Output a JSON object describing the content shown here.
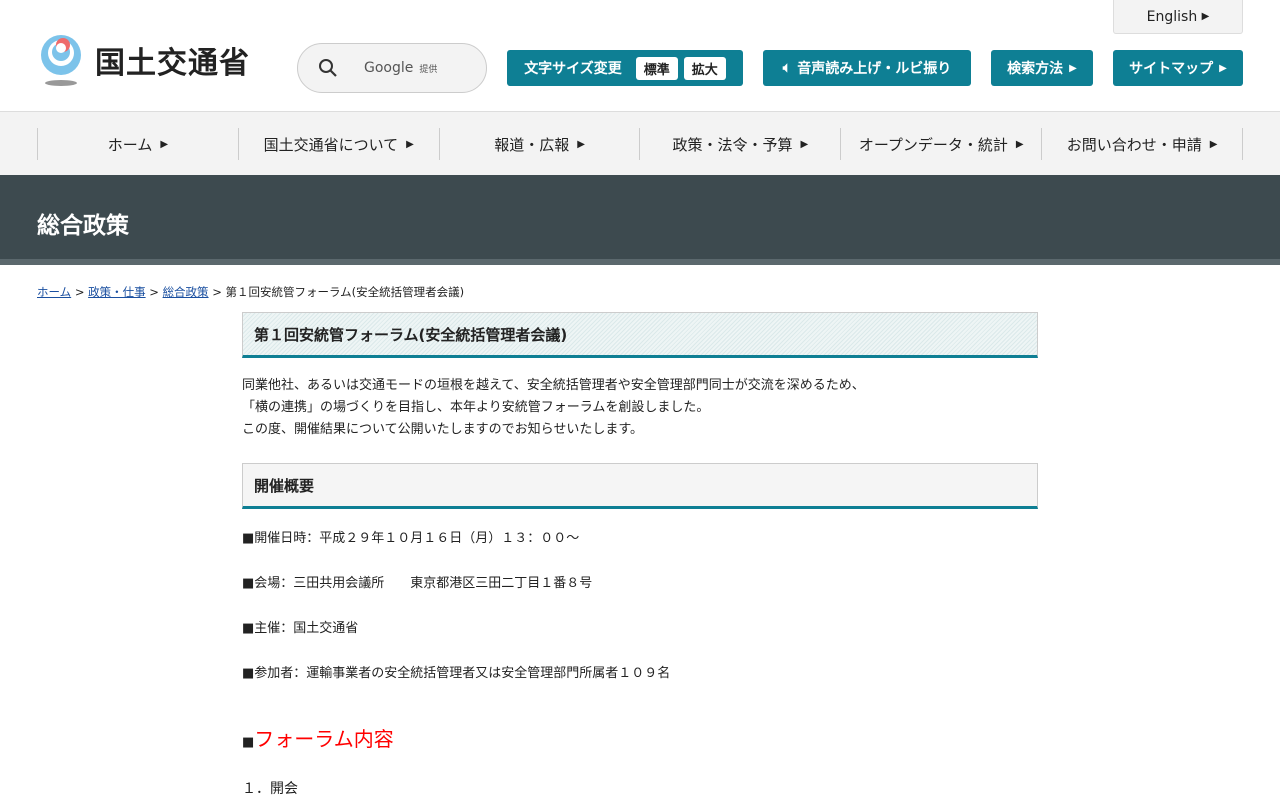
{
  "header": {
    "logo_text": "国土交通省",
    "search": {
      "provider": "Google",
      "provider_suffix": "提供"
    },
    "font_size": {
      "label": "文字サイズ変更",
      "standard": "標準",
      "large": "拡大"
    },
    "speech": "音声読み上げ・ルビ振り",
    "search_method": "検索方法",
    "sitemap": "サイトマップ",
    "english": "English"
  },
  "nav": [
    "ホーム",
    "国土交通省について",
    "報道・広報",
    "政策・法令・予算",
    "オープンデータ・統計",
    "お問い合わせ・申請"
  ],
  "section_title": "総合政策",
  "breadcrumb": {
    "items": [
      "ホーム",
      "政策・仕事",
      "総合政策"
    ],
    "current": "第１回安統管フォーラム(安全統括管理者会議)",
    "sep": ">"
  },
  "main": {
    "title": "第１回安統管フォーラム(安全統括管理者会議)",
    "intro": [
      "同業他社、あるいは交通モードの垣根を越えて、安全統括管理者や安全管理部門同士が交流を深めるため、",
      "「横の連携」の場づくりを目指し、本年より安統管フォーラムを創設しました。",
      "この度、開催結果について公開いたしますのでお知らせいたします。"
    ],
    "overview_title": "開催概要",
    "overview": [
      "■開催日時：平成２９年１０月１６日（月）１３：００～",
      "■会場：三田共用会議所　　東京都港区三田二丁目１番８号",
      "■主催：国土交通省",
      "■参加者：運輸事業者の安全統括管理者又は安全管理部門所属者１０９名"
    ],
    "content_bullet": "■",
    "content_title": "フォーラム内容",
    "first_item": "１．開会"
  },
  "colors": {
    "accent": "#0e7f94",
    "band": "#3d4a4f"
  }
}
